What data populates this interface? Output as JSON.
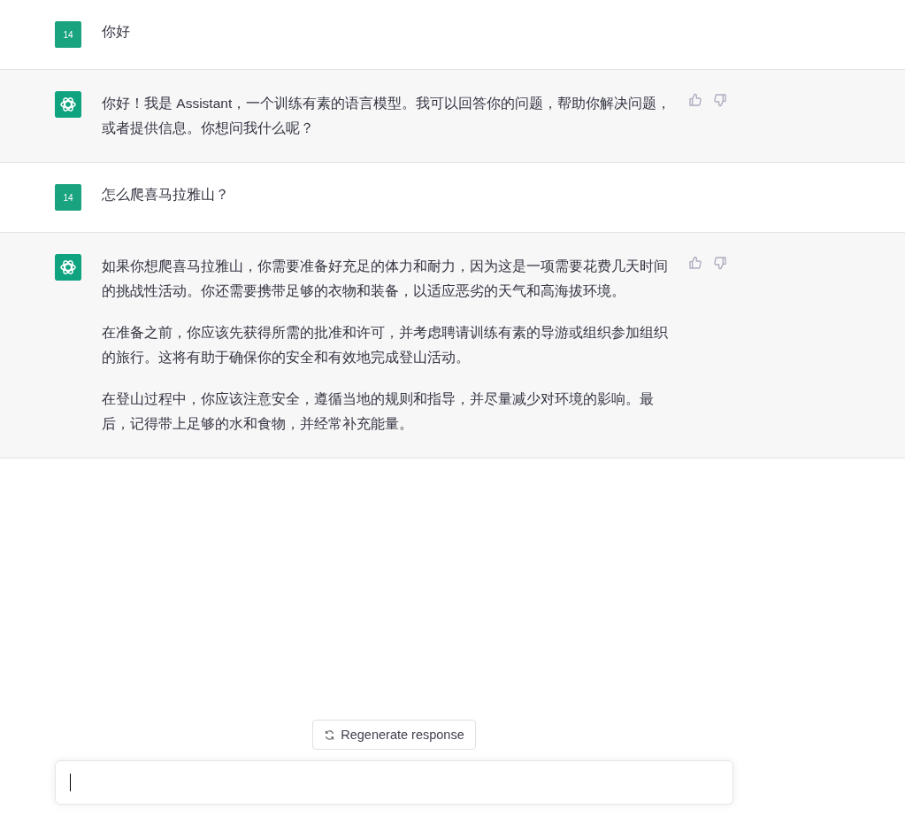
{
  "messages": [
    {
      "kind": "user",
      "avatar": "14",
      "paragraphs": [
        "你好"
      ]
    },
    {
      "kind": "assistant",
      "paragraphs": [
        "你好！我是 Assistant，一个训练有素的语言模型。我可以回答你的问题，帮助你解决问题，或者提供信息。你想问我什么呢？"
      ]
    },
    {
      "kind": "user",
      "avatar": "14",
      "paragraphs": [
        "怎么爬喜马拉雅山？"
      ]
    },
    {
      "kind": "assistant",
      "paragraphs": [
        "如果你想爬喜马拉雅山，你需要准备好充足的体力和耐力，因为这是一项需要花费几天时间的挑战性活动。你还需要携带足够的衣物和装备，以适应恶劣的天气和高海拔环境。",
        "在准备之前，你应该先获得所需的批准和许可，并考虑聘请训练有素的导游或组织参加组织的旅行。这将有助于确保你的安全和有效地完成登山活动。",
        "在登山过程中，你应该注意安全，遵循当地的规则和指导，并尽量减少对环境的影响。最后，记得带上足够的水和食物，并经常补充能量。"
      ]
    }
  ],
  "regenerate_button": "Regenerate response"
}
